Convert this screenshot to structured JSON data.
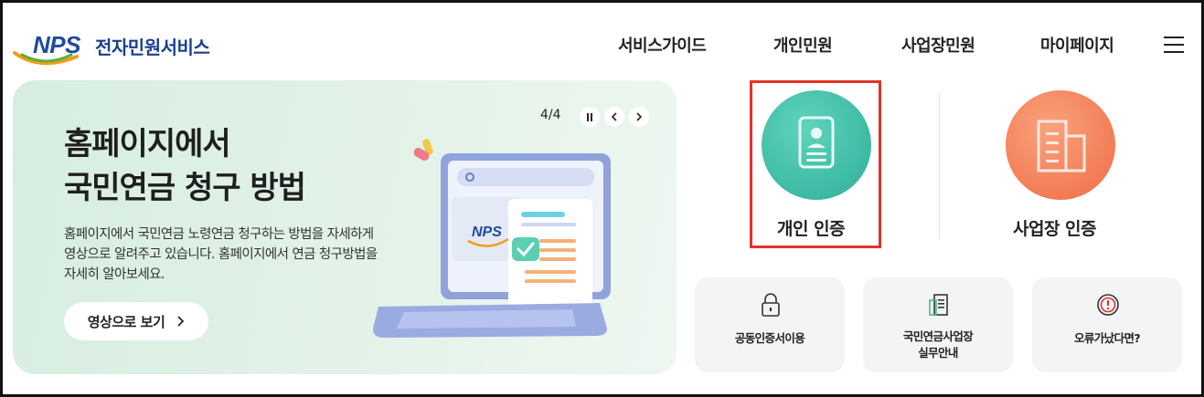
{
  "header": {
    "logo_text": "NPS",
    "service_name": "전자민원서비스",
    "nav": [
      "서비스가이드",
      "개인민원",
      "사업장민원",
      "마이페이지"
    ]
  },
  "banner": {
    "title_line1": "홈페이지에서",
    "title_line2": "국민연금 청구 방법",
    "description": "홈페이지에서 국민연금 노령연금 청구하는 방법을 자세하게 영상으로 알려주고 있습니다. 홈페이지에서 연금 청구방법을 자세히 알아보세요.",
    "button_label": "영상으로 보기",
    "page_indicator": "4/4",
    "illustration_logo": "NPS"
  },
  "auth": {
    "personal_label": "개인 인증",
    "business_label": "사업장 인증"
  },
  "quick": [
    {
      "label": "공동인증서이용",
      "icon": "lock-icon"
    },
    {
      "label": "국민연금사업장\n실무안내",
      "icon": "document-icon"
    },
    {
      "label": "오류가났다면?",
      "icon": "alert-icon"
    }
  ],
  "colors": {
    "brand": "#1f4aa3",
    "banner_bg": "#dff0e5",
    "personal_circle": "#3cc0a8",
    "business_circle": "#f47c54",
    "highlight": "#e53327"
  }
}
